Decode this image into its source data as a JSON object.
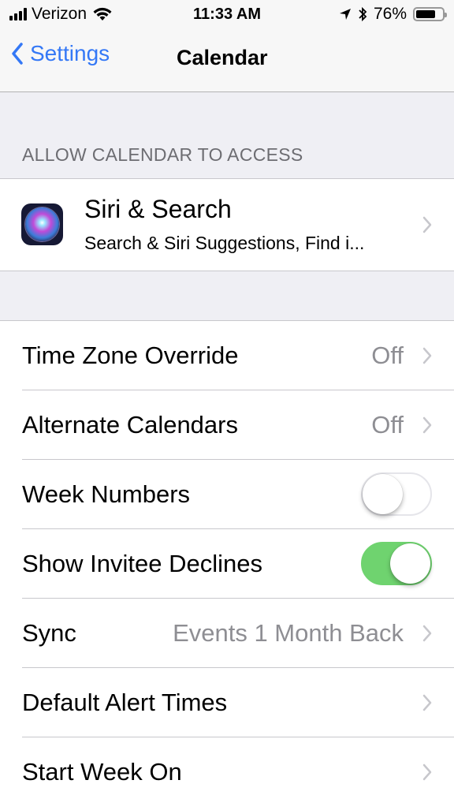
{
  "status_bar": {
    "carrier": "Verizon",
    "time": "11:33 AM",
    "battery_percent": "76%",
    "battery_level": 0.76,
    "icons": [
      "signal-bars-icon",
      "wifi-icon",
      "location-arrow-icon",
      "bluetooth-icon",
      "battery-icon"
    ]
  },
  "nav": {
    "back_label": "Settings",
    "title": "Calendar"
  },
  "section_header": "ALLOW CALENDAR TO ACCESS",
  "siri": {
    "title": "Siri & Search",
    "subtitle": "Search & Siri Suggestions, Find i..."
  },
  "settings": [
    {
      "label": "Time Zone Override",
      "value": "Off",
      "type": "disclosure"
    },
    {
      "label": "Alternate Calendars",
      "value": "Off",
      "type": "disclosure"
    },
    {
      "label": "Week Numbers",
      "type": "toggle",
      "on": false
    },
    {
      "label": "Show Invitee Declines",
      "type": "toggle",
      "on": true
    },
    {
      "label": "Sync",
      "value": "Events 1 Month Back",
      "type": "disclosure"
    },
    {
      "label": "Default Alert Times",
      "value": "",
      "type": "disclosure"
    },
    {
      "label": "Start Week On",
      "value": "",
      "type": "disclosure"
    }
  ],
  "colors": {
    "accent": "#3478f6",
    "toggle_on": "#6fd36f",
    "background": "#efeff4",
    "secondary_text": "#8e8e93"
  }
}
